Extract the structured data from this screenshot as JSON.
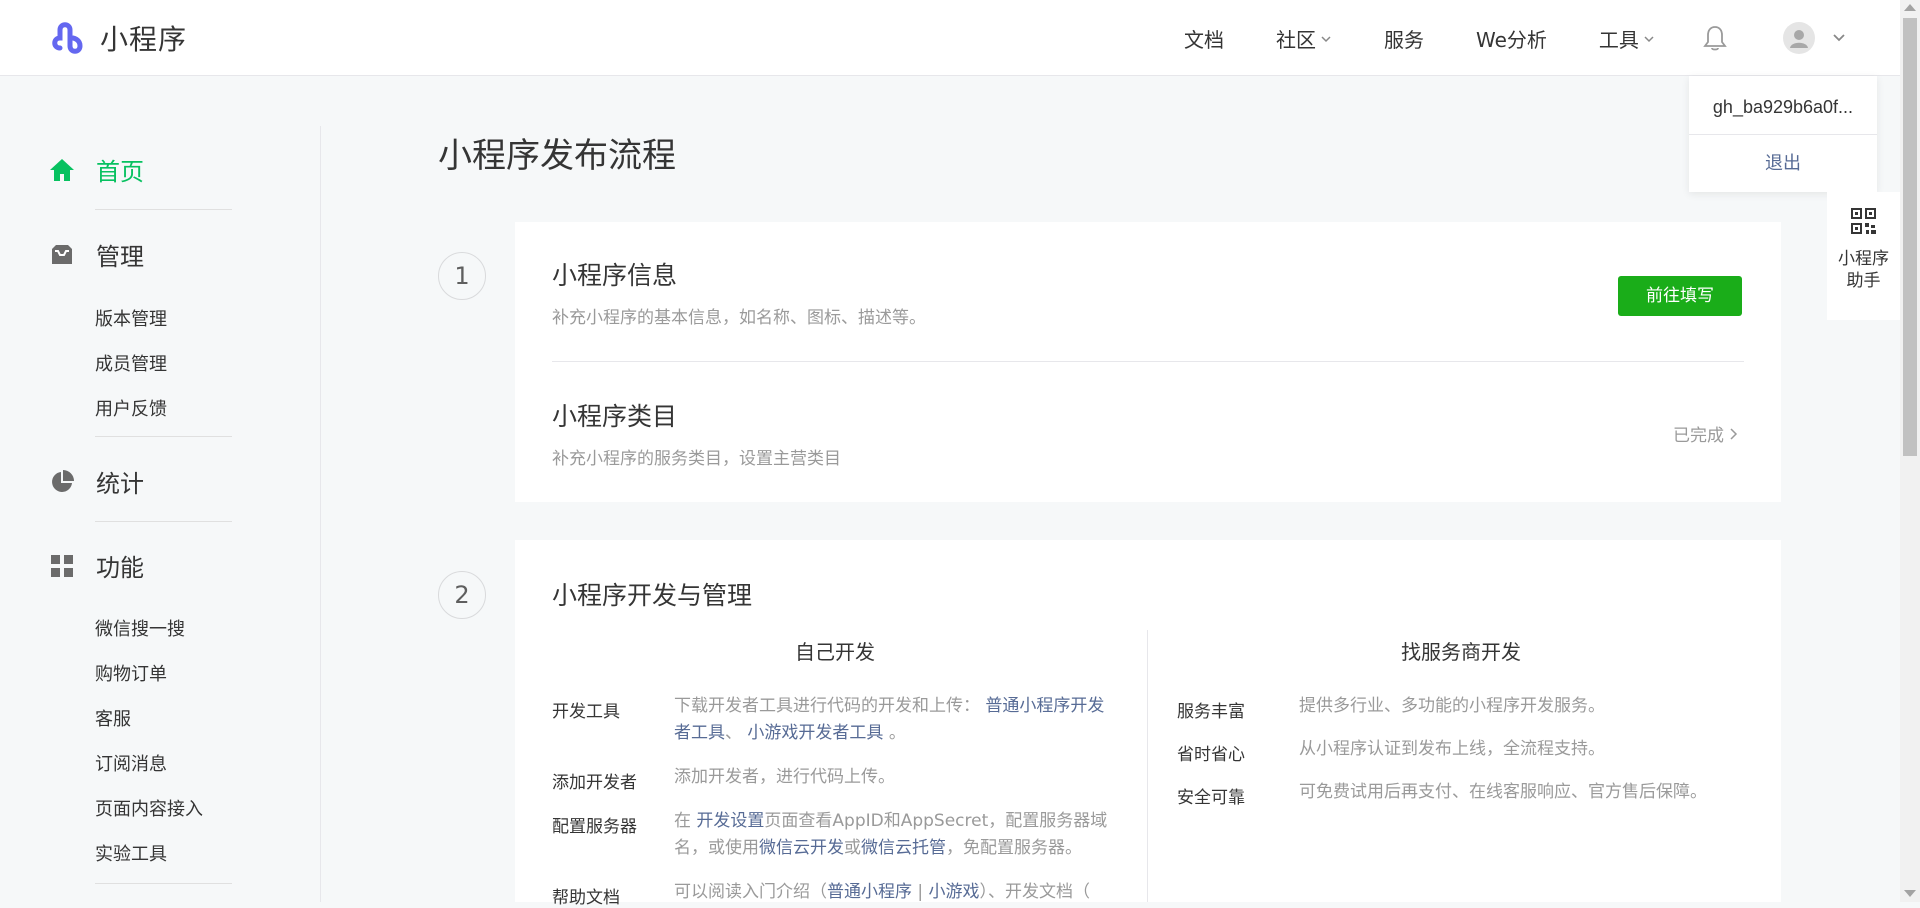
{
  "header": {
    "app_name": "小程序",
    "nav": [
      {
        "label": "文档",
        "has_dropdown": false
      },
      {
        "label": "社区",
        "has_dropdown": true
      },
      {
        "label": "服务",
        "has_dropdown": false
      },
      {
        "label": "We分析",
        "has_dropdown": false
      },
      {
        "label": "工具",
        "has_dropdown": true
      }
    ]
  },
  "user_menu": {
    "account_id": "gh_ba929b6a0f...",
    "logout": "退出"
  },
  "assistant": {
    "label": "小程序助手"
  },
  "sidebar": {
    "home": "首页",
    "manage": "管理",
    "manage_items": [
      "版本管理",
      "成员管理",
      "用户反馈"
    ],
    "stats": "统计",
    "features": "功能",
    "feature_items": [
      "微信搜一搜",
      "购物订单",
      "客服",
      "订阅消息",
      "页面内容接入",
      "实验工具"
    ]
  },
  "main": {
    "title": "小程序发布流程",
    "step1": {
      "number": "1",
      "info_title": "小程序信息",
      "info_desc": "补充小程序的基本信息，如名称、图标、描述等。",
      "info_button": "前往填写",
      "category_title": "小程序类目",
      "category_desc": "补充小程序的服务类目，设置主营类目",
      "category_status": "已完成"
    },
    "step2": {
      "number": "2",
      "title": "小程序开发与管理",
      "self_dev": {
        "title": "自己开发",
        "dev_tools_label": "开发工具",
        "dev_tools_text": "下载开发者工具进行代码的开发和上传：",
        "dev_tools_link1": "普通小程序开发者工具",
        "dev_tools_sep": "、",
        "dev_tools_link2": "小游戏开发者工具",
        "dev_tools_end": "。",
        "add_dev_label": "添加开发者",
        "add_dev_text": "添加开发者，进行代码上传。",
        "server_label": "配置服务器",
        "server_text_1": "在",
        "server_link1": "开发设置",
        "server_text_2": "页面查看AppID和AppSecret，配置服务器域名，或使用",
        "server_link2": "微信云开发",
        "server_text_3": "或",
        "server_link3": "微信云托管",
        "server_text_4": "，免配置服务器。",
        "docs_label": "帮助文档",
        "docs_text_1": "可以阅读入门介绍（",
        "docs_link1": "普通小程序",
        "docs_sep": "|",
        "docs_link2": "小游戏",
        "docs_text_2": "）、开发文档（"
      },
      "provider": {
        "title": "找服务商开发",
        "items": [
          {
            "label": "服务丰富",
            "text": "提供多行业、多功能的小程序开发服务。"
          },
          {
            "label": "省时省心",
            "text": "从小程序认证到发布上线，全流程支持。"
          },
          {
            "label": "安全可靠",
            "text": "可免费试用后再支付、在线客服响应、官方售后保障。"
          }
        ]
      }
    }
  },
  "colors": {
    "accent_green": "#07c160",
    "button_green": "#1aad19",
    "link_blue": "#576b95",
    "logo_purple": "#6467f0"
  }
}
